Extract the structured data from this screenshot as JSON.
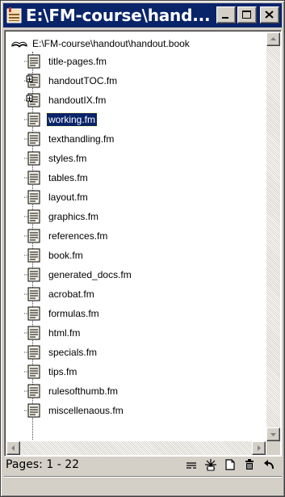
{
  "window": {
    "title": "E:\\FM-course\\hand...",
    "buttons": [
      "minimize",
      "maximize",
      "close"
    ]
  },
  "book": {
    "path": "E:\\FM-course\\handout\\handout.book",
    "files": [
      {
        "name": "title-pages.fm",
        "icon": "document-icon",
        "selected": false
      },
      {
        "name": "handoutTOC.fm",
        "icon": "generated-toc-icon",
        "selected": false
      },
      {
        "name": "handoutIX.fm",
        "icon": "generated-index-icon",
        "selected": false
      },
      {
        "name": "working.fm",
        "icon": "document-icon",
        "selected": true
      },
      {
        "name": "texthandling.fm",
        "icon": "document-icon",
        "selected": false
      },
      {
        "name": "styles.fm",
        "icon": "document-icon",
        "selected": false
      },
      {
        "name": "tables.fm",
        "icon": "document-icon",
        "selected": false
      },
      {
        "name": "layout.fm",
        "icon": "document-icon",
        "selected": false
      },
      {
        "name": "graphics.fm",
        "icon": "document-icon",
        "selected": false
      },
      {
        "name": "references.fm",
        "icon": "document-icon",
        "selected": false
      },
      {
        "name": "book.fm",
        "icon": "document-icon",
        "selected": false
      },
      {
        "name": "generated_docs.fm",
        "icon": "document-icon",
        "selected": false
      },
      {
        "name": "acrobat.fm",
        "icon": "document-icon",
        "selected": false
      },
      {
        "name": "formulas.fm",
        "icon": "document-icon",
        "selected": false
      },
      {
        "name": "html.fm",
        "icon": "document-icon",
        "selected": false
      },
      {
        "name": "specials.fm",
        "icon": "document-icon",
        "selected": false
      },
      {
        "name": "tips.fm",
        "icon": "document-icon",
        "selected": false
      },
      {
        "name": "rulesofthumb.fm",
        "icon": "document-icon",
        "selected": false
      },
      {
        "name": "miscellenaous.fm",
        "icon": "document-icon",
        "selected": false
      }
    ]
  },
  "status": {
    "pages": "Pages: 1 - 22",
    "icons": [
      "properties-icon",
      "update-icon",
      "new-file-icon",
      "delete-icon",
      "undo-icon"
    ]
  },
  "colors": {
    "titlebar": "#0a246a",
    "selection": "#0a246a",
    "chrome": "#d4d0c8"
  }
}
